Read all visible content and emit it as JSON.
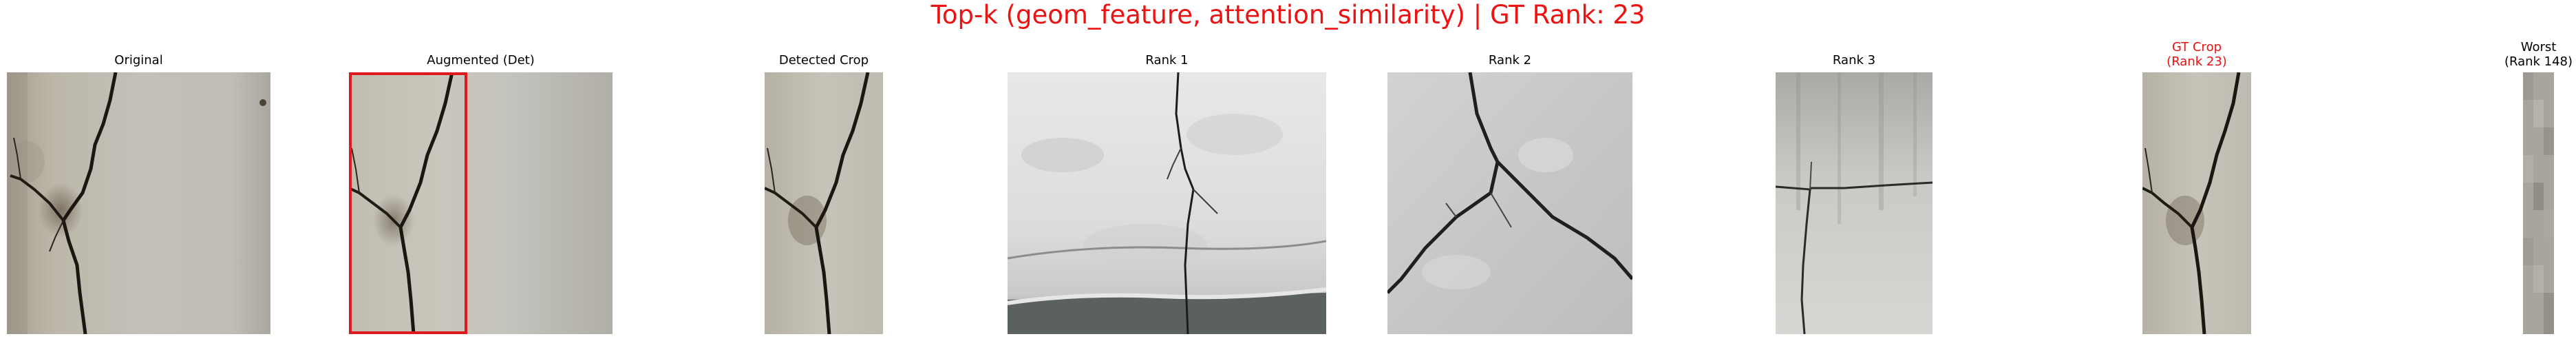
{
  "figure": {
    "title": "Top-k (geom_feature, attention_similarity) | GT Rank: 23",
    "title_color": "#ee1111"
  },
  "panels": [
    {
      "title": "Original",
      "image": "concrete-wall-crack-photo"
    },
    {
      "title": "Augmented (Det)",
      "image": "concrete-wall-crack-photo-with-red-detection-box"
    },
    {
      "title": "Detected Crop",
      "image": "cropped-concrete-crack-photo"
    },
    {
      "title": "Rank 1",
      "image": "white-painted-surface-crack-photo"
    },
    {
      "title": "Rank 2",
      "image": "grey-plaster-branching-crack-photo"
    },
    {
      "title": "Rank 3",
      "image": "weathered-concrete-crack-photo"
    },
    {
      "title": "GT Crop\n(Rank 23)",
      "image": "ground-truth-crack-crop-photo"
    },
    {
      "title": "Worst\n(Rank 148)",
      "image": "narrow-pixelated-grey-strip"
    }
  ],
  "colors": {
    "gt_title": "#ee1111",
    "detection_box": "#e0191f"
  }
}
